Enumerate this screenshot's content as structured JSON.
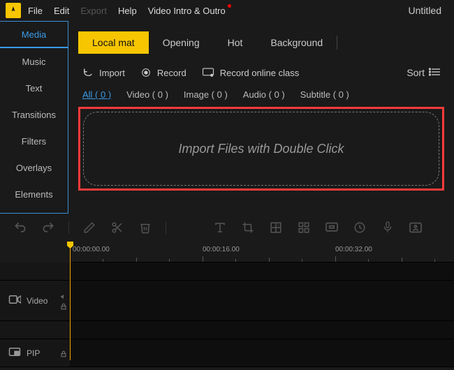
{
  "menu": {
    "file": "File",
    "edit": "Edit",
    "export": "Export",
    "help": "Help",
    "video_intro": "Video Intro & Outro"
  },
  "title": "Untitled",
  "sidebar": {
    "items": [
      "Media",
      "Music",
      "Text",
      "Transitions",
      "Filters",
      "Overlays",
      "Elements"
    ]
  },
  "tabs": {
    "local": "Local mat",
    "opening": "Opening",
    "hot": "Hot",
    "background": "Background"
  },
  "actions": {
    "import": "Import",
    "record": "Record",
    "record_online": "Record online class",
    "sort": "Sort"
  },
  "filters": {
    "all": "All ( 0 )",
    "video": "Video ( 0 )",
    "image": "Image ( 0 )",
    "audio": "Audio ( 0 )",
    "subtitle": "Subtitle ( 0 )"
  },
  "dropzone": "Import Files with Double Click",
  "ruler": {
    "t0": "00:00:00.00",
    "t1": "00:00:16.00",
    "t2": "00:00:32.00"
  },
  "tracks": {
    "video": "Video",
    "pip": "PIP"
  }
}
